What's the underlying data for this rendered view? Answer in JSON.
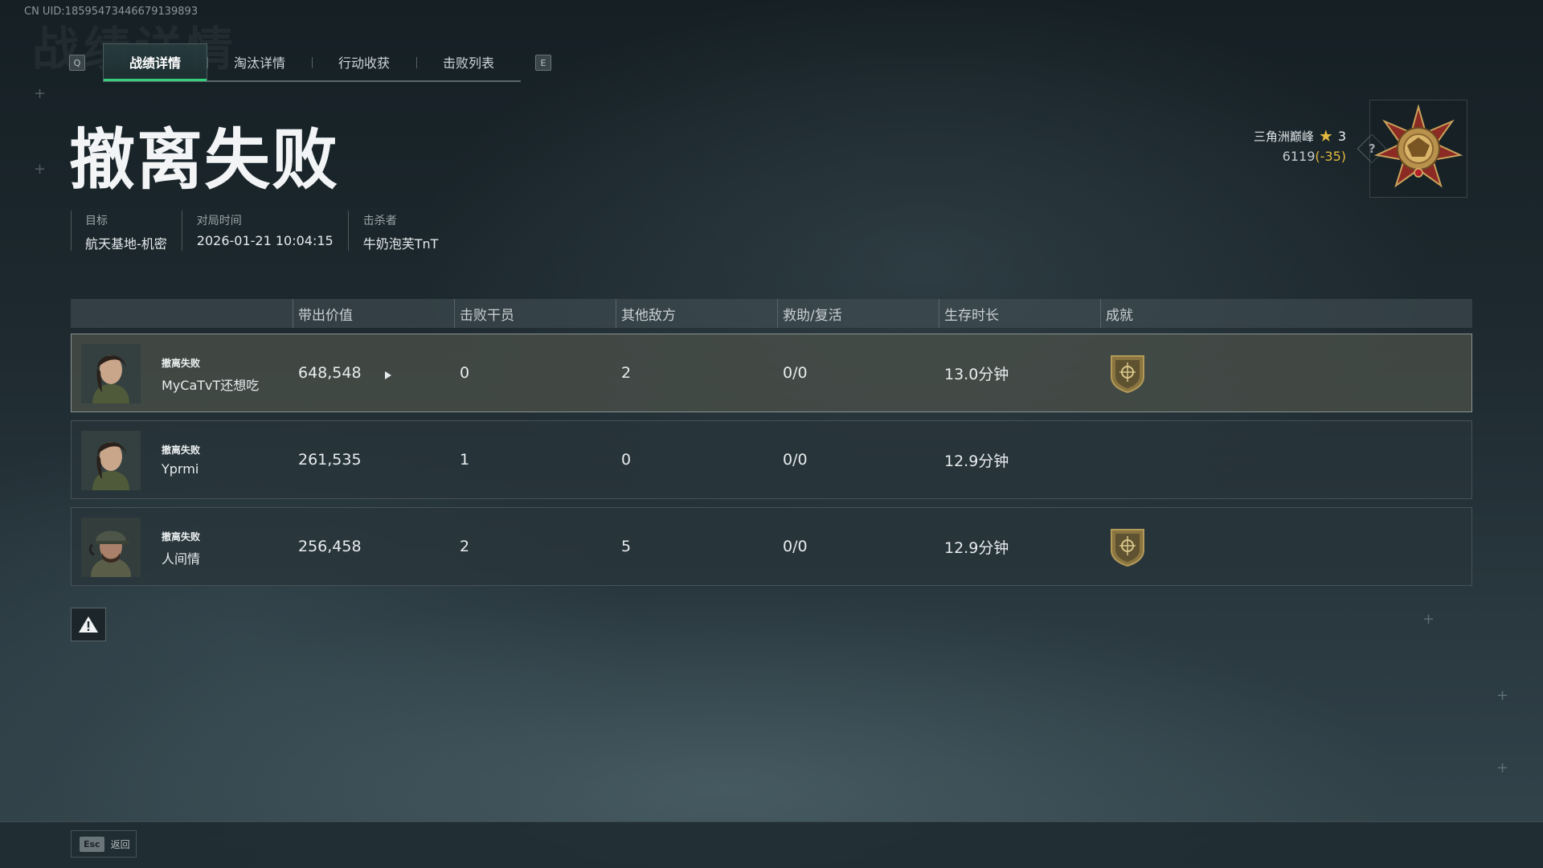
{
  "uid": "CN UID:18595473446679139893",
  "tabs": {
    "left_key": "Q",
    "right_key": "E",
    "items": [
      "战绩详情",
      "淘汰详情",
      "行动收获",
      "击败列表"
    ],
    "active": "战绩详情"
  },
  "title": "撤离失败",
  "info": {
    "target_label": "目标",
    "target_value": "航天基地-机密",
    "time_label": "对局时间",
    "time_value": "2026-01-21 10:04:15",
    "killer_label": "击杀者",
    "killer_value": "牛奶泡芙TnT"
  },
  "rank": {
    "name": "三角洲巅峰",
    "stars": "3",
    "score": "6119",
    "delta": "(-35)",
    "help": "?",
    "star_color": "#e2b93e"
  },
  "table": {
    "headers": [
      "带出价值",
      "击败干员",
      "其他敌方",
      "救助/复活",
      "生存时长",
      "成就"
    ],
    "rows": [
      {
        "status": "撤离失败",
        "name": "MyCaTvT还想吃",
        "value": "648,548",
        "kills": "0",
        "other": "2",
        "assist": "0/0",
        "survival": "13.0分钟",
        "achievement": "shield-achievement-icon"
      },
      {
        "status": "撤离失败",
        "name": "Yprmi",
        "value": "261,535",
        "kills": "1",
        "other": "0",
        "assist": "0/0",
        "survival": "12.9分钟",
        "achievement": ""
      },
      {
        "status": "撤离失败",
        "name": "人间情",
        "value": "256,458",
        "kills": "2",
        "other": "5",
        "assist": "0/0",
        "survival": "12.9分钟",
        "achievement": "shield-achievement-icon"
      }
    ]
  },
  "bottom": {
    "esc_key": "Esc",
    "esc_label": "返回"
  },
  "colors": {
    "accent_green": "#35d07a",
    "gold": "#e2b93e"
  }
}
